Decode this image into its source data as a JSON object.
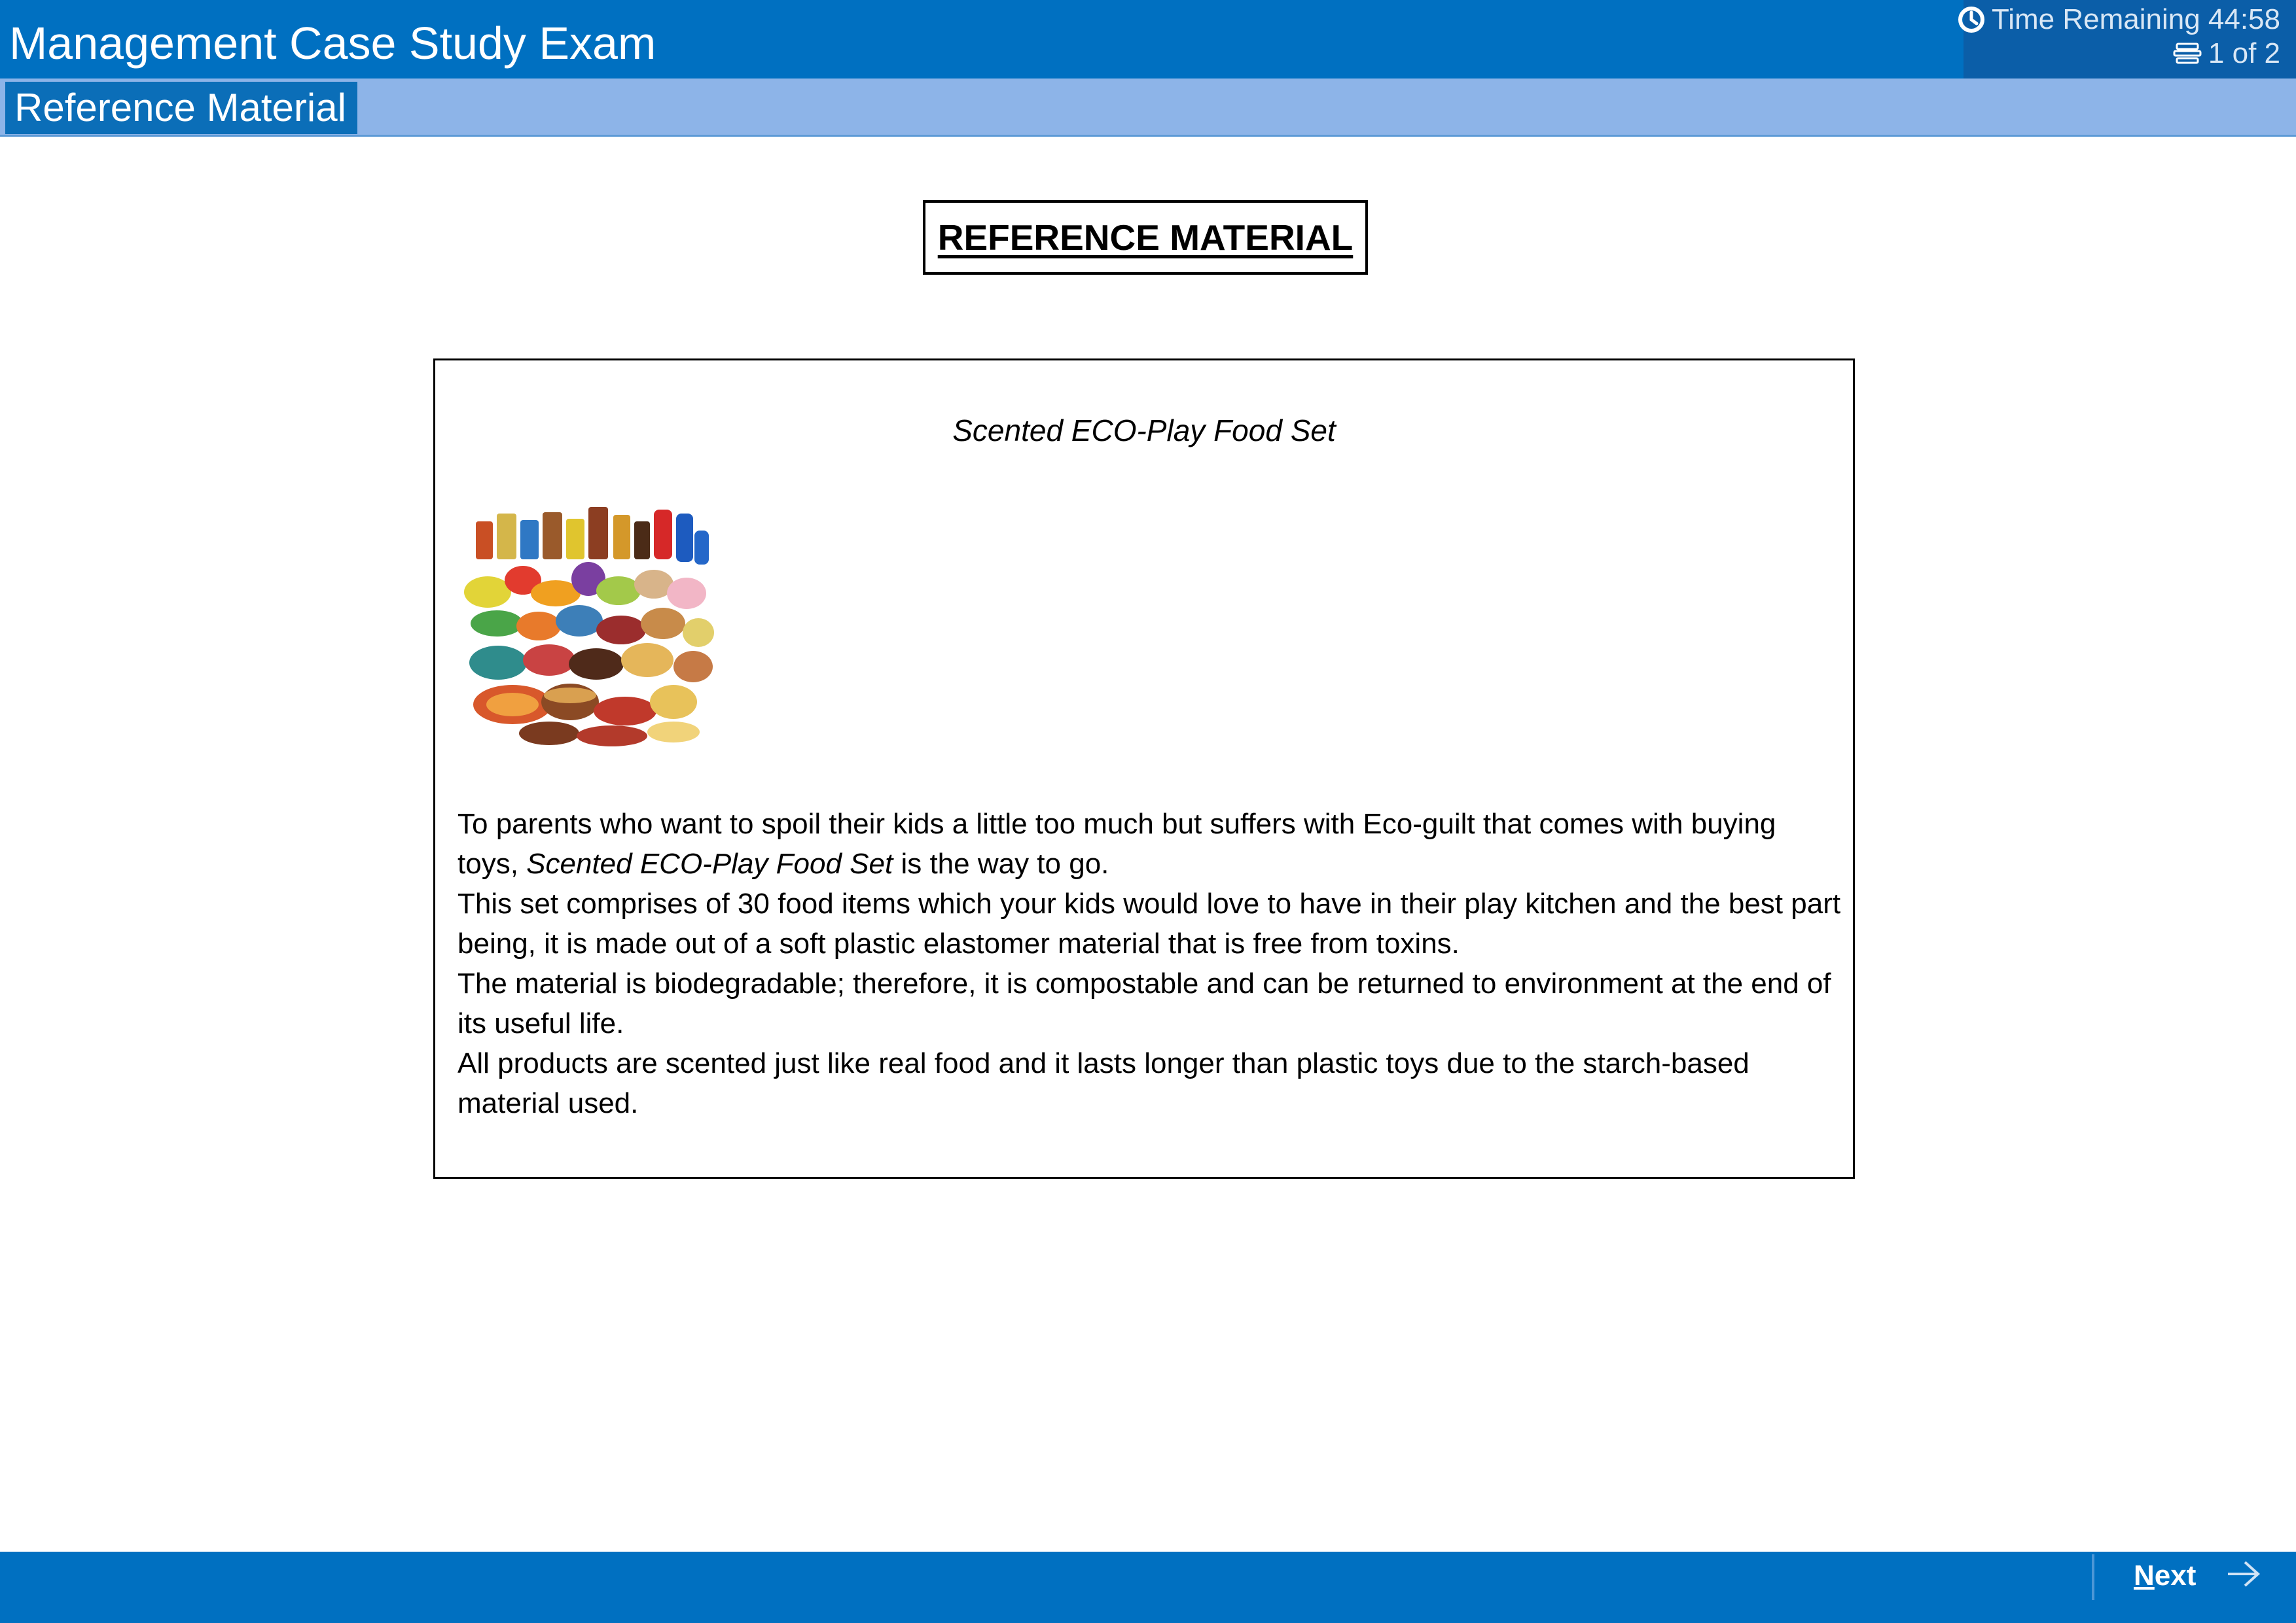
{
  "header": {
    "title": "Management Case Study Exam",
    "timer_label": "Time Remaining 44:58",
    "page_indicator": "1 of 2",
    "timer_icon": "clock-icon",
    "page_icon": "flag-icon"
  },
  "subbar": {
    "section_label": "Reference Material"
  },
  "content": {
    "heading": "REFERENCE MATERIAL",
    "product_title": "Scented ECO-Play Food Set",
    "image_subject": "pile of toy food items",
    "paragraphs": [
      {
        "before": "To parents who want to spoil their kids a little too much but suffers with Eco-guilt that comes with buying toys, ",
        "emphasis": "Scented ECO-Play Food Set",
        "after": " is the way to go."
      },
      {
        "text": "This set comprises of 30 food items which your kids would love to have in their play kitchen and the best part being, it is made out of a soft plastic elastomer material that is free from toxins."
      },
      {
        "text": "The material is biodegradable; therefore, it is compostable and can be returned to environment at the end of its useful life."
      },
      {
        "text": "All products are scented just like real food and it lasts longer than plastic toys due to the starch-based material used."
      }
    ]
  },
  "footer": {
    "next_first_letter": "N",
    "next_rest": "ext",
    "next_icon": "arrow-right-icon"
  },
  "colors": {
    "header_blue": "#0070c1",
    "subbar_blue": "#8db4e8",
    "tab_blue": "#0b6eb8",
    "status_panel": "#0b5ea8"
  }
}
